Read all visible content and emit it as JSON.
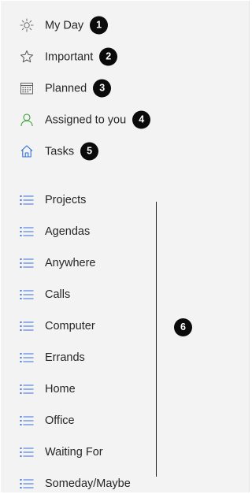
{
  "smart_lists": [
    {
      "label": "My Day",
      "badge": "1",
      "icon": "sun-icon"
    },
    {
      "label": "Important",
      "badge": "2",
      "icon": "star-icon"
    },
    {
      "label": "Planned",
      "badge": "3",
      "icon": "calendar-icon"
    },
    {
      "label": "Assigned to you",
      "badge": "4",
      "icon": "person-icon"
    },
    {
      "label": "Tasks",
      "badge": "5",
      "icon": "home-icon"
    }
  ],
  "custom_lists": [
    {
      "label": "Projects",
      "icon": "list-icon"
    },
    {
      "label": "Agendas",
      "icon": "list-icon"
    },
    {
      "label": "Anywhere",
      "icon": "list-icon"
    },
    {
      "label": "Calls",
      "icon": "list-icon"
    },
    {
      "label": "Computer",
      "icon": "list-icon"
    },
    {
      "label": "Errands",
      "icon": "list-icon"
    },
    {
      "label": "Home",
      "icon": "list-icon"
    },
    {
      "label": "Office",
      "icon": "list-icon"
    },
    {
      "label": "Waiting For",
      "icon": "list-icon"
    },
    {
      "label": "Someday/Maybe",
      "icon": "list-icon"
    }
  ],
  "custom_lists_badge": "6",
  "colors": {
    "background": "#f3f3f3",
    "list_icon_blue": "#3a6fd8",
    "person_icon_green": "#3e9e3e",
    "home_icon_blue": "#2f6fd6",
    "neutral_icon": "#606060",
    "badge": "#0b0b0b"
  }
}
